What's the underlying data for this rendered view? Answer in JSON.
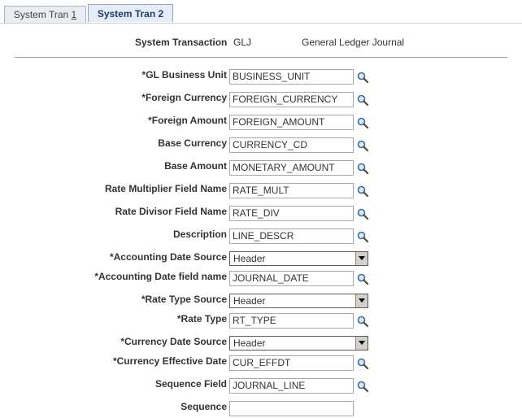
{
  "tabs": [
    {
      "label_pre": "System Tran ",
      "label_u": "1",
      "active": false
    },
    {
      "label": "System Tran 2",
      "active": true
    }
  ],
  "header": {
    "label": "System Transaction",
    "code": "GLJ",
    "description": "General Ledger Journal"
  },
  "fields": {
    "gl_business_unit": {
      "label": "*GL Business Unit",
      "value": "BUSINESS_UNIT"
    },
    "foreign_currency": {
      "label": "*Foreign Currency",
      "value": "FOREIGN_CURRENCY"
    },
    "foreign_amount": {
      "label": "*Foreign Amount",
      "value": "FOREIGN_AMOUNT"
    },
    "base_currency": {
      "label": "Base Currency",
      "value": "CURRENCY_CD"
    },
    "base_amount": {
      "label": "Base Amount",
      "value": "MONETARY_AMOUNT"
    },
    "rate_multiplier": {
      "label": "Rate Multiplier Field Name",
      "value": "RATE_MULT"
    },
    "rate_divisor": {
      "label": "Rate Divisor Field Name",
      "value": "RATE_DIV"
    },
    "description": {
      "label": "Description",
      "value": "LINE_DESCR"
    },
    "accounting_date_source": {
      "label": "*Accounting Date Source",
      "value": "Header"
    },
    "accounting_date_field": {
      "label": "*Accounting Date field name",
      "value": "JOURNAL_DATE"
    },
    "rate_type_source": {
      "label": "*Rate Type Source",
      "value": "Header"
    },
    "rate_type": {
      "label": "*Rate Type",
      "value": "RT_TYPE"
    },
    "currency_date_source": {
      "label": "*Currency Date Source",
      "value": "Header"
    },
    "currency_effective_date": {
      "label": "*Currency Effective Date",
      "value": "CUR_EFFDT"
    },
    "sequence_field": {
      "label": "Sequence Field",
      "value": "JOURNAL_LINE"
    },
    "sequence": {
      "label": "Sequence",
      "value": ""
    }
  },
  "icons": {
    "lookup": "magnifier-icon",
    "dropdown": "chevron-down-icon"
  },
  "colors": {
    "tab_active_bg": "#e3ecf7",
    "tab_inactive_bg": "#e9edf2",
    "lookup_blue": "#2f6fb3"
  }
}
